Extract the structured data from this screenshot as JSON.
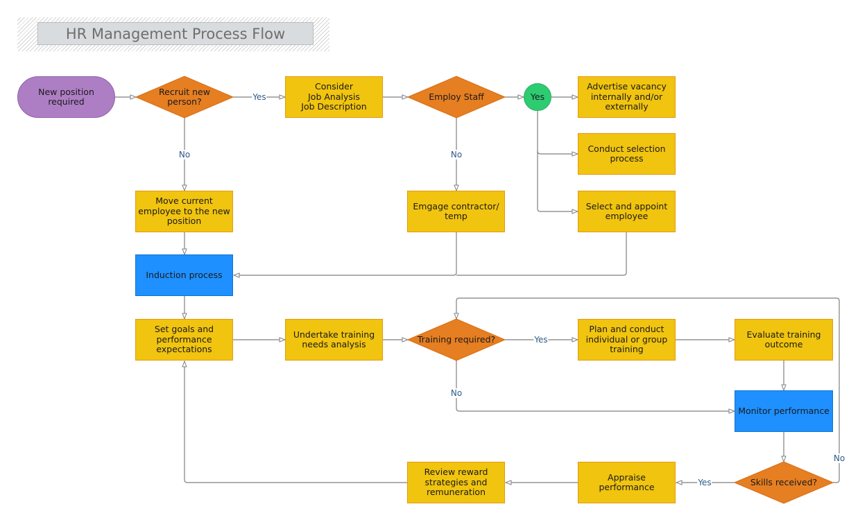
{
  "title": "HR Management Process Flow",
  "colors": {
    "process": "#f1c40f",
    "decision": "#e67e22",
    "highlight": "#1e90ff",
    "terminal": "#ae7ec5",
    "connector": "#2ecc71",
    "edge": "#7f7f7f",
    "edge_label": "#2d5a87"
  },
  "nodes": {
    "start": "New position\nrequired",
    "recruit": "Recruit new\nperson?",
    "consider": "Consider\nJob Analysis\nJob Description",
    "employ": "Employ Staff",
    "yes_connector": "Yes",
    "advertise": "Advertise vacancy\ninternally and/or\nexternally",
    "selection": "Conduct selection\nprocess",
    "appoint": "Select and appoint\nemployee",
    "move": "Move current\nemployee to the new\nposition",
    "contractor": "Emgage contractor/\ntemp",
    "induction": "Induction process",
    "goals": "Set goals and\nperformance\nexpectations",
    "tna": "Undertake training\nneeds analysis",
    "training_req": "Training required?",
    "plan_training": "Plan and conduct\nindividual or group\ntraining",
    "evaluate": "Evaluate training\noutcome",
    "monitor": "Monitor performance",
    "skills": "Skills received?",
    "appraise": "Appraise\nperformance",
    "review": "Review reward\nstrategies and\nremuneration"
  },
  "edge_labels": {
    "recruit_yes": "Yes",
    "recruit_no": "No",
    "employ_no": "No",
    "training_yes": "Yes",
    "training_no": "No",
    "skills_yes": "Yes",
    "skills_no": "No"
  }
}
